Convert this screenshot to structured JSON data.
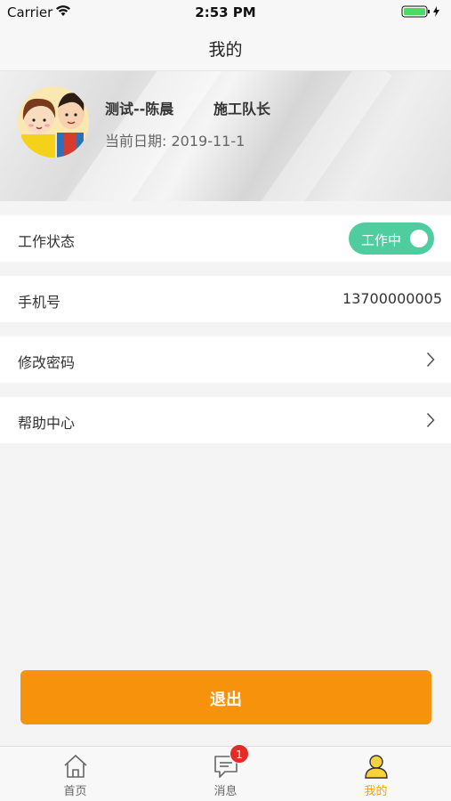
{
  "status_bar": {
    "carrier": "Carrier",
    "time": "2:53 PM",
    "battery_color": "#4cd964"
  },
  "nav": {
    "title": "我的"
  },
  "profile": {
    "name": "测试--陈晨",
    "role": "施工队长",
    "date_text": "当前日期: 2019-11-1",
    "avatar_icon": "cartoon-couple-avatar"
  },
  "rows": {
    "work_status": {
      "label": "工作状态",
      "toggle_label": "工作中",
      "toggle_on": true,
      "toggle_color": "#4fcd9f"
    },
    "phone": {
      "label": "手机号",
      "value": "13700000005"
    },
    "change_password": {
      "label": "修改密码",
      "icon": "chevron-right-icon"
    },
    "help_center": {
      "label": "帮助中心",
      "icon": "chevron-right-icon"
    }
  },
  "logout": {
    "label": "退出",
    "color": "#f7920c"
  },
  "tabs": [
    {
      "label": "首页",
      "icon": "home-icon",
      "active": false
    },
    {
      "label": "消息",
      "icon": "message-icon",
      "active": false,
      "badge": "1"
    },
    {
      "label": "我的",
      "icon": "user-icon",
      "active": true
    }
  ],
  "accent_color": "#f3a30a",
  "badge_color": "#e52b26"
}
